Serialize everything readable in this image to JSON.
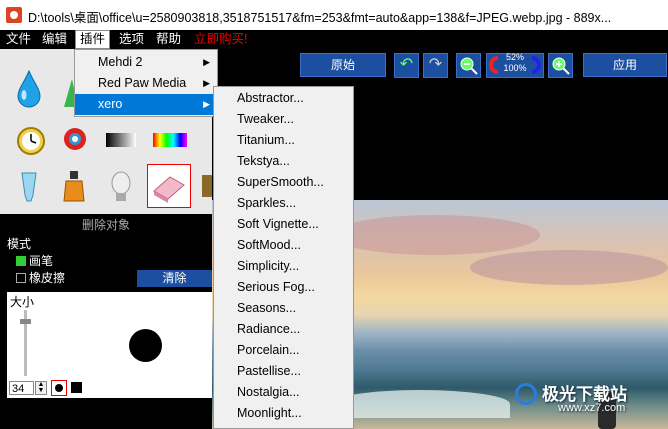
{
  "window": {
    "title": "D:\\tools\\桌面\\office\\u=2580903818,3518751517&fm=253&fmt=auto&app=138&f=JPEG.webp.jpg - 889x..."
  },
  "menubar": [
    {
      "label": "文件"
    },
    {
      "label": "编辑"
    },
    {
      "label": "插件"
    },
    {
      "label": "选项"
    },
    {
      "label": "帮助"
    },
    {
      "label": "立即购买!"
    }
  ],
  "plugin_menu": {
    "items": [
      {
        "label": "Mehdi 2"
      },
      {
        "label": "Red Paw Media"
      },
      {
        "label": "xero"
      }
    ]
  },
  "xero_submenu": {
    "items": [
      "Abstractor...",
      "Tweaker...",
      "Titanium...",
      "Tekstya...",
      "SuperSmooth...",
      "Sparkles...",
      "Soft Vignette...",
      "SoftMood...",
      "Simplicity...",
      "Serious Fog...",
      "Seasons...",
      "Radiance...",
      "Porcelain...",
      "Pastellise...",
      "Nostalgia...",
      "Moonlight..."
    ]
  },
  "tools": [
    {
      "icon": "water-drop-icon"
    },
    {
      "icon": "clock-icon"
    },
    {
      "icon": "color-circle-icon"
    },
    {
      "icon": "gradient-bar-icon"
    },
    {
      "icon": "rainbow-bar-icon"
    },
    {
      "icon": "test-tube-icon"
    },
    {
      "icon": "bottle-icon"
    },
    {
      "icon": "bulb-icon"
    },
    {
      "icon": "eraser-icon"
    }
  ],
  "options": {
    "header": "删除对象",
    "mode_label": "模式",
    "brush_label": "画笔",
    "eraser_label": "橡皮擦",
    "brush_checked": true,
    "eraser_checked": false,
    "clear_button": "清除"
  },
  "brush": {
    "size_label": "大小",
    "size_value": "34"
  },
  "toolbar": {
    "original_button": "原始",
    "apply_button": "应用",
    "zoom_percent": "52%",
    "zoom_actual": "100%"
  },
  "watermark": {
    "text": "极光下载站",
    "url": "www.xz7.com"
  },
  "colors": {
    "accent": "#1c4f9f",
    "highlight": "#0078d7",
    "buy": "#e00000"
  }
}
